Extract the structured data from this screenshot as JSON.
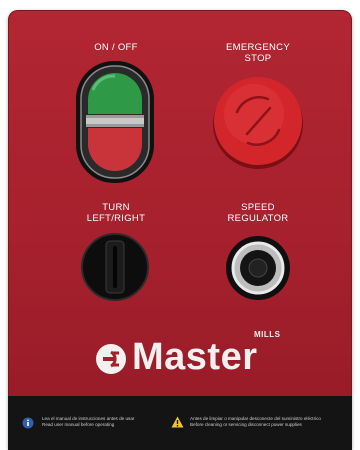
{
  "controls": {
    "on_off": {
      "label": "ON / OFF"
    },
    "emergency_stop": {
      "label": "EMERGENCY\nSTOP"
    },
    "turn": {
      "label": "TURN\nLEFT/RIGHT"
    },
    "speed": {
      "label": "SPEED\nREGULATOR"
    }
  },
  "brand": {
    "name": "Master",
    "sub": "MILLS"
  },
  "footer": {
    "note_left": "Lea el manual de instrucciones antes de usar\nRead user manual before operating",
    "note_right": "Antes de limpiar o manipular desconecte del suministro eléctrico\nBefore cleaning or servicing disconnect power supplies"
  },
  "colors": {
    "panel": "#a5202d",
    "start_green": "#2e9a48",
    "stop_red": "#c8343a",
    "emergency_red": "#d3262b",
    "footer": "#141414"
  },
  "icons": {
    "info": "info-icon",
    "warning": "warning-icon",
    "brand_mark": "power-plug-logo-icon"
  }
}
